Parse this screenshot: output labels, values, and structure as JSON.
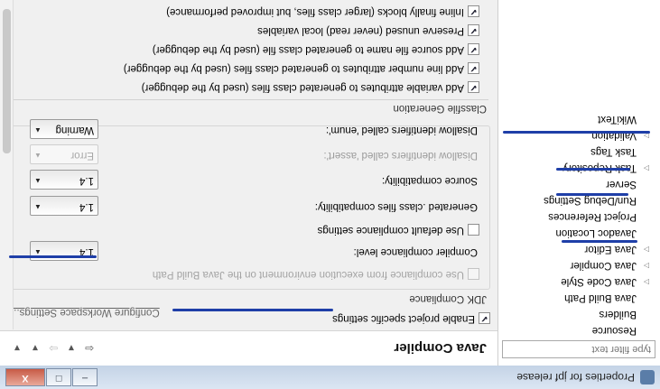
{
  "window": {
    "title": "Properties for jpf release",
    "minimize_glyph": "–",
    "maximize_glyph": "□",
    "close_glyph": "X"
  },
  "sidebar": {
    "filter_placeholder": "type filter text",
    "items": [
      {
        "label": "Resource",
        "expandable": false
      },
      {
        "label": "Builders",
        "expandable": false
      },
      {
        "label": "Java Build Path",
        "expandable": false
      },
      {
        "label": "Java Code Style",
        "expandable": true
      },
      {
        "label": "Java Compiler",
        "expandable": true,
        "selected": true
      },
      {
        "label": "Java Editor",
        "expandable": true
      },
      {
        "label": "Javadoc Location",
        "expandable": false
      },
      {
        "label": "Project References",
        "expandable": false
      },
      {
        "label": "Run/Debug Settings",
        "expandable": false
      },
      {
        "label": "Server",
        "expandable": false
      },
      {
        "label": "Task Repository",
        "expandable": true
      },
      {
        "label": "Task Tags",
        "expandable": false
      },
      {
        "label": "Validation",
        "expandable": true
      },
      {
        "label": "WikiText",
        "expandable": false
      }
    ]
  },
  "page": {
    "title": "Java Compiler",
    "nav": {
      "back": "⇦",
      "back_menu": "▾",
      "forward": "⇨",
      "forward_menu": "▾",
      "menu": "▾"
    },
    "enable_project_specific": {
      "label": "Enable project specific settings",
      "checked": true
    },
    "configure_link": "Configure Workspace Settings...",
    "jdk_compliance": {
      "title": "JDK Compliance",
      "use_ee": {
        "label": "Use compliance from execution environment on the Java Build Path",
        "checked": false,
        "disabled": true
      },
      "compliance_level": {
        "label": "Compiler compliance level:",
        "value": "1.4"
      },
      "use_default": {
        "label": "Use default compliance settings",
        "checked": false
      },
      "generated_class": {
        "label": "Generated .class files compatibility:",
        "value": "1.4"
      },
      "source_compat": {
        "label": "Source compatibility:",
        "value": "1.4"
      },
      "assert_ident": {
        "label": "Disallow identifiers called 'assert':",
        "value": "Error",
        "disabled": true
      },
      "enum_ident": {
        "label": "Disallow identifiers called 'enum':",
        "value": "Warning"
      }
    },
    "classfile": {
      "title": "Classfile Generation",
      "options": [
        {
          "label": "Add variable attributes to generated class files (used by the debugger)",
          "checked": true
        },
        {
          "label": "Add line number attributes to generated class files (used by the debugger)",
          "checked": true
        },
        {
          "label": "Add source file name to generated class file (used by the debugger)",
          "checked": true
        },
        {
          "label": "Preserve unused (never read) local variables",
          "checked": true
        },
        {
          "label": "Inline finally blocks (larger class files, but improved performance)",
          "checked": true
        }
      ]
    }
  },
  "glyphs": {
    "check": "✔",
    "collapsed_arrow": "▷",
    "combo_arrow": "▲"
  },
  "colors": {
    "annotation": "#1f3fa8",
    "titlebar": "#c4d3e6"
  }
}
